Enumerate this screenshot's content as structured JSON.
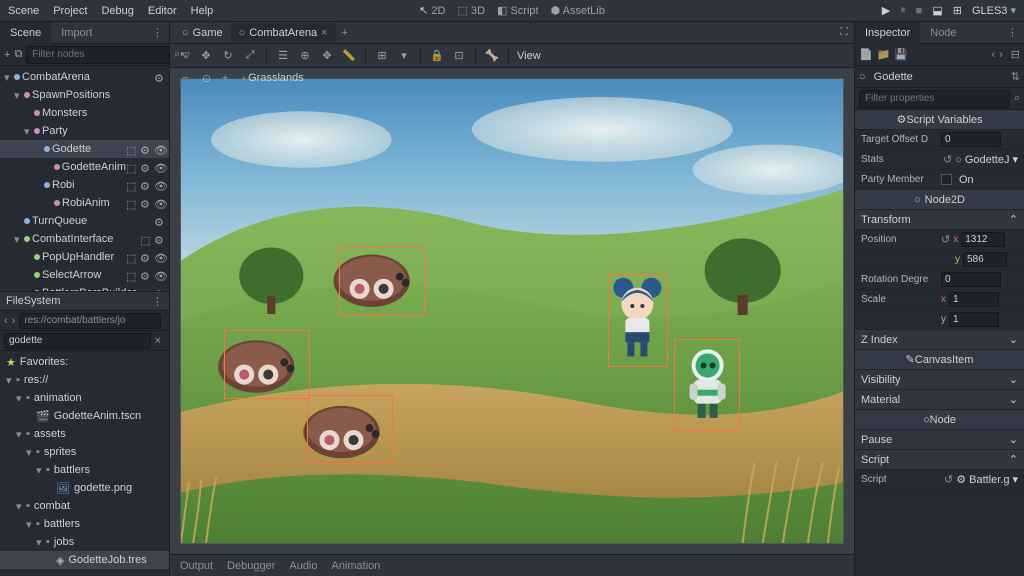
{
  "menu": {
    "items": [
      "Scene",
      "Project",
      "Debug",
      "Editor",
      "Help"
    ]
  },
  "workspace_tabs": {
    "items": [
      "2D",
      "3D",
      "Script",
      "AssetLib"
    ],
    "active": 0
  },
  "renderer": "GLES3",
  "scene_dock": {
    "tabs": [
      "Scene",
      "Import"
    ],
    "active": 0,
    "filter_placeholder": "Filter nodes",
    "tree": [
      {
        "depth": 0,
        "label": "CombatArena",
        "icon": "node2d",
        "expand": true,
        "icons": [
          "script"
        ]
      },
      {
        "depth": 1,
        "label": "SpawnPositions",
        "icon": "linked",
        "expand": true,
        "icons": []
      },
      {
        "depth": 2,
        "label": "Monsters",
        "icon": "pos",
        "icons": []
      },
      {
        "depth": 2,
        "label": "Party",
        "icon": "pos",
        "expand": true,
        "icons": []
      },
      {
        "depth": 3,
        "label": "Godette",
        "icon": "node2d",
        "sel": true,
        "icons": [
          "inst",
          "script",
          "vis"
        ]
      },
      {
        "depth": 4,
        "label": "GodetteAnim",
        "icon": "linked",
        "icons": [
          "inst",
          "script",
          "vis"
        ]
      },
      {
        "depth": 3,
        "label": "Robi",
        "icon": "node2d",
        "icons": [
          "inst",
          "script",
          "vis"
        ]
      },
      {
        "depth": 4,
        "label": "RobiAnim",
        "icon": "linked",
        "icons": [
          "inst",
          "script",
          "vis"
        ]
      },
      {
        "depth": 1,
        "label": "TurnQueue",
        "icon": "ysort",
        "icons": [
          "script"
        ]
      },
      {
        "depth": 1,
        "label": "CombatInterface",
        "icon": "control",
        "expand": true,
        "icons": [
          "inst",
          "script"
        ]
      },
      {
        "depth": 2,
        "label": "PopUpHandler",
        "icon": "dot-g",
        "icons": [
          "inst",
          "script",
          "vis"
        ]
      },
      {
        "depth": 2,
        "label": "SelectArrow",
        "icon": "dot-g",
        "icons": [
          "inst",
          "script",
          "vis"
        ]
      },
      {
        "depth": 2,
        "label": "BattlersBarsBuilder",
        "icon": "dot-g",
        "icons": [
          "inst",
          "script"
        ]
      }
    ]
  },
  "filesystem": {
    "title": "FileSystem",
    "path": "res://combat/battlers/jo",
    "search": "godette",
    "favorites_label": "Favorites:",
    "tree": [
      {
        "depth": 0,
        "label": "res://",
        "icon": "folder",
        "expand": true
      },
      {
        "depth": 1,
        "label": "animation",
        "icon": "folder",
        "expand": true
      },
      {
        "depth": 2,
        "label": "GodetteAnim.tscn",
        "icon": "scene"
      },
      {
        "depth": 1,
        "label": "assets",
        "icon": "folder",
        "expand": true
      },
      {
        "depth": 2,
        "label": "sprites",
        "icon": "folder",
        "expand": true
      },
      {
        "depth": 3,
        "label": "battlers",
        "icon": "folder",
        "expand": true
      },
      {
        "depth": 4,
        "label": "godette.png",
        "icon": "image"
      },
      {
        "depth": 1,
        "label": "combat",
        "icon": "folder",
        "expand": true
      },
      {
        "depth": 2,
        "label": "battlers",
        "icon": "folder",
        "expand": true
      },
      {
        "depth": 3,
        "label": "jobs",
        "icon": "folder",
        "expand": true
      },
      {
        "depth": 4,
        "label": "GodetteJob.tres",
        "icon": "res",
        "sel": true
      }
    ]
  },
  "scene_tabs": {
    "items": [
      {
        "label": "Game"
      },
      {
        "label": "CombatArena",
        "active": true
      }
    ]
  },
  "viewport": {
    "view_menu": "View",
    "breadcrumb": "Grasslands"
  },
  "bottom_panel": {
    "items": [
      "Output",
      "Debugger",
      "Audio",
      "Animation"
    ]
  },
  "inspector": {
    "tabs": [
      "Inspector",
      "Node"
    ],
    "active": 0,
    "object_name": "Godette",
    "filter_placeholder": "Filter properties",
    "sections": {
      "script_vars": "Script Variables",
      "node2d": "Node2D",
      "transform": "Transform",
      "canvasitem": "CanvasItem",
      "node": "Node"
    },
    "props": {
      "target_offset_label": "Target Offset D",
      "target_offset": "0",
      "stats_label": "Stats",
      "stats_val": "GodetteJ",
      "party_member_label": "Party Member",
      "party_member": "On",
      "position_label": "Position",
      "position_x": "1312",
      "position_y": "586",
      "rotation_label": "Rotation Degre",
      "rotation": "0",
      "scale_label": "Scale",
      "scale_x": "1",
      "scale_y": "1",
      "zindex_label": "Z Index",
      "visibility_label": "Visibility",
      "material_label": "Material",
      "pause_label": "Pause",
      "script_label_sec": "Script",
      "script_label": "Script",
      "script_val": "Battler.g"
    }
  }
}
